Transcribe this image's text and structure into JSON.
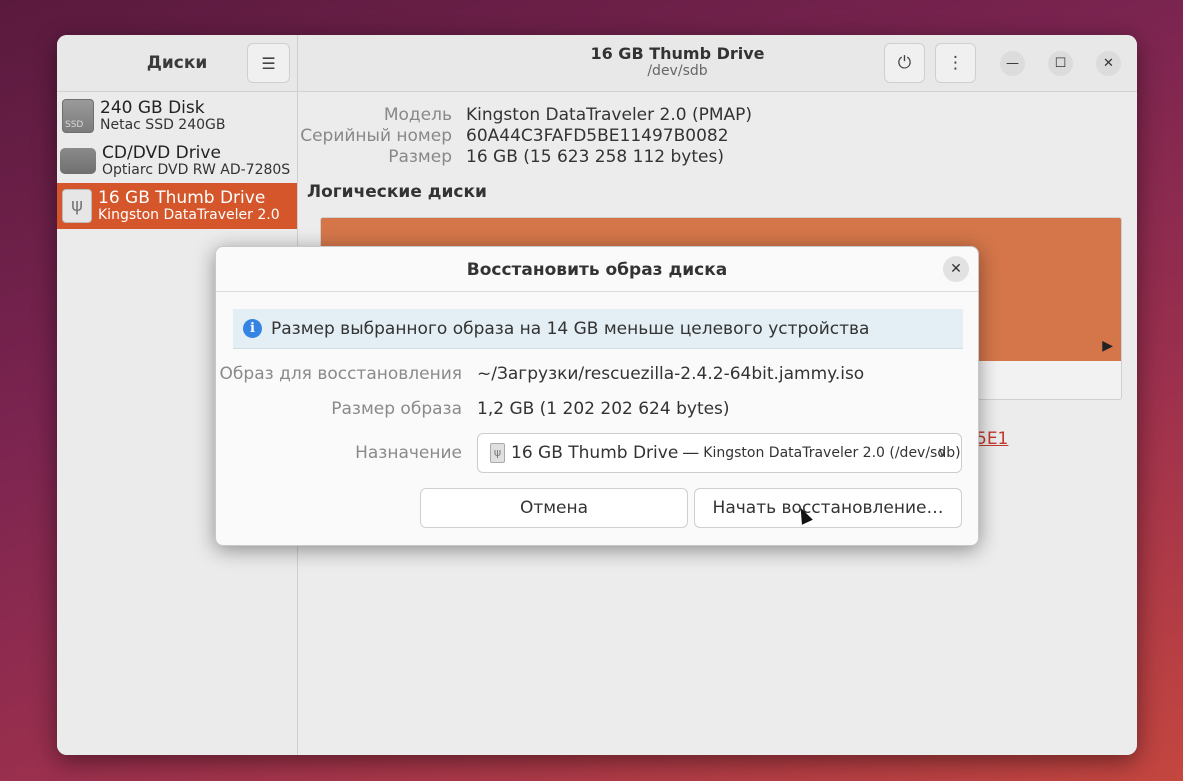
{
  "sidebar": {
    "title": "Диски",
    "menu_icon": "hamburger-icon",
    "disks": [
      {
        "name": "240 GB Disk",
        "model": "Netac SSD 240GB",
        "icon": "ssd-icon"
      },
      {
        "name": "CD/DVD Drive",
        "model": "Optiarc DVD RW AD-7280S",
        "icon": "optical-drive-icon"
      },
      {
        "name": "16 GB Thumb Drive",
        "model": "Kingston DataTraveler 2.0",
        "icon": "usb-drive-icon",
        "selected": true
      }
    ]
  },
  "header": {
    "title": "16 GB Thumb Drive",
    "subtitle": "/dev/sdb",
    "power_icon": "power-icon",
    "more_icon": "kebab-menu-icon",
    "minimize_symbol": "—",
    "maximize_symbol": "☐",
    "close_symbol": "✕"
  },
  "drive_info": {
    "model_label": "Модель",
    "model_value": "Kingston DataTraveler 2.0 (PMAP)",
    "serial_label": "Серийный номер",
    "serial_value": "60A44C3FAFD5BE11497B0082",
    "size_label": "Размер",
    "size_value": "16 GB (15 623 258 112 bytes)"
  },
  "volumes": {
    "title": "Логические диски",
    "link_fragment": "5E1"
  },
  "dialog": {
    "title": "Восстановить образ диска",
    "close_symbol": "✕",
    "info_text": "Размер выбранного образа на 14 GB меньше целевого устройства",
    "image_label": "Образ для восстановления",
    "image_value": "~/Загрузки/rescuezilla-2.4.2-64bit.jammy.iso",
    "image_size_label": "Размер образа",
    "image_size_value": "1,2 GB (1 202 202 624 bytes)",
    "destination_label": "Назначение",
    "destination_name": "16 GB Thumb Drive",
    "destination_dash": "—",
    "destination_detail": "Kingston DataTraveler 2.0 (/dev/sdb)",
    "cancel_label": "Отмена",
    "start_label": "Начать восстановление…"
  }
}
